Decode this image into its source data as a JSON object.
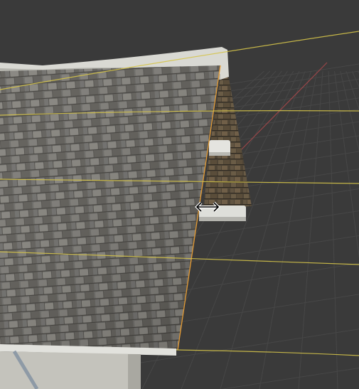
{
  "viewport": {
    "label": "",
    "background": "#3a3a3a",
    "grid_color": "#474747",
    "selection_color": "#d4c34a",
    "axis_x_color": "#b04446"
  },
  "cursor": {
    "icon": "horizontal-resize-icon"
  },
  "scene": {
    "roof_texture": "slate-shingles",
    "trim_color": "#d9d9d3",
    "wall_color": "#bdbcb5"
  }
}
